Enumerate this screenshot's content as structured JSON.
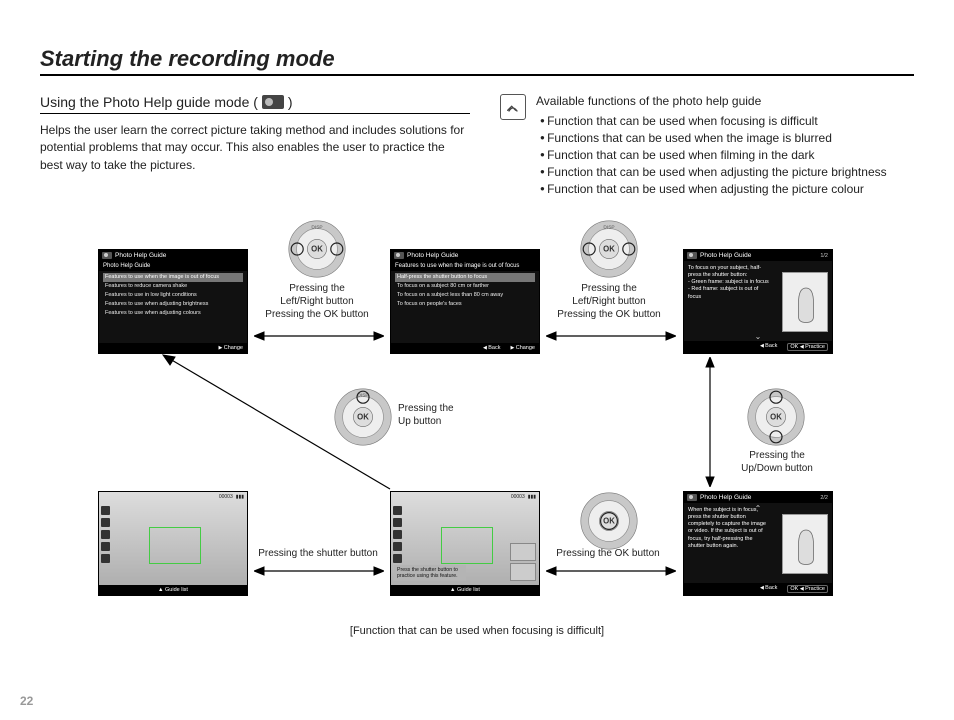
{
  "page": {
    "title": "Starting the recording mode",
    "number": "22"
  },
  "section": {
    "heading_prefix": "Using the Photo Help guide mode (",
    "heading_suffix": ")",
    "intro": "Helps the user learn the correct picture taking method and includes solutions for potential problems that may occur. This also enables the user to practice the best way to take the pictures."
  },
  "note": {
    "title": "Available functions of the photo help guide",
    "items": [
      "Function that can be used when focusing is difficult",
      "Functions that can be used when the image is blurred",
      "Function that can be used when filming in the dark",
      "Function that can be used when adjusting the picture brightness",
      "Function that can be used when adjusting the picture colour"
    ]
  },
  "labels": {
    "lr_ok": "Pressing the\nLeft/Right button\nPressing the OK button",
    "up": "Pressing the\nUp button",
    "updown": "Pressing the\nUp/Down button",
    "shutter": "Pressing the shutter button",
    "okonly": "Pressing the OK button",
    "caption": "[Function that can be used when focusing is difficult]"
  },
  "screens": {
    "s1": {
      "title": "Photo Help Guide",
      "subtitle": "Photo Help Guide",
      "items": [
        "Features to use when the image is out of focus",
        "Features to reduce camera shake",
        "Features to use in low light conditions",
        "Features to use when adjusting brightness",
        "Features to use when adjusting colours"
      ],
      "footer_r": "Change"
    },
    "s2": {
      "title": "Photo Help Guide",
      "subtitle": "Features to use when the image is out of focus",
      "items": [
        "Half-press the shutter button to focus",
        "To focus on a subject 80 cm or farther",
        "To focus on a subject less than 80 cm away",
        "To focus on people's faces"
      ],
      "footer_l": "Back",
      "footer_r": "Change"
    },
    "s3": {
      "title": "Photo Help Guide",
      "page": "1/2",
      "body": "To focus on your subject, half-press the shutter button:\n- Green frame: subject is in focus\n- Red frame: subject is out of focus",
      "footer_l": "Back",
      "footer_ok": "Practice"
    },
    "s4": {
      "title": "Photo Help Guide",
      "page": "2/2",
      "body": "When the subject is in focus, press the shutter button completely to capture the image or video. If the subject is out of focus, try half-pressing the shutter button again.",
      "footer_l": "Back",
      "footer_ok": "Practice"
    },
    "photoA": {
      "footer": "Guide list",
      "count": "00003"
    },
    "photoB": {
      "footer": "Guide list",
      "overlay": "Press the shutter button to practice using this feature.",
      "count": "00003"
    }
  }
}
